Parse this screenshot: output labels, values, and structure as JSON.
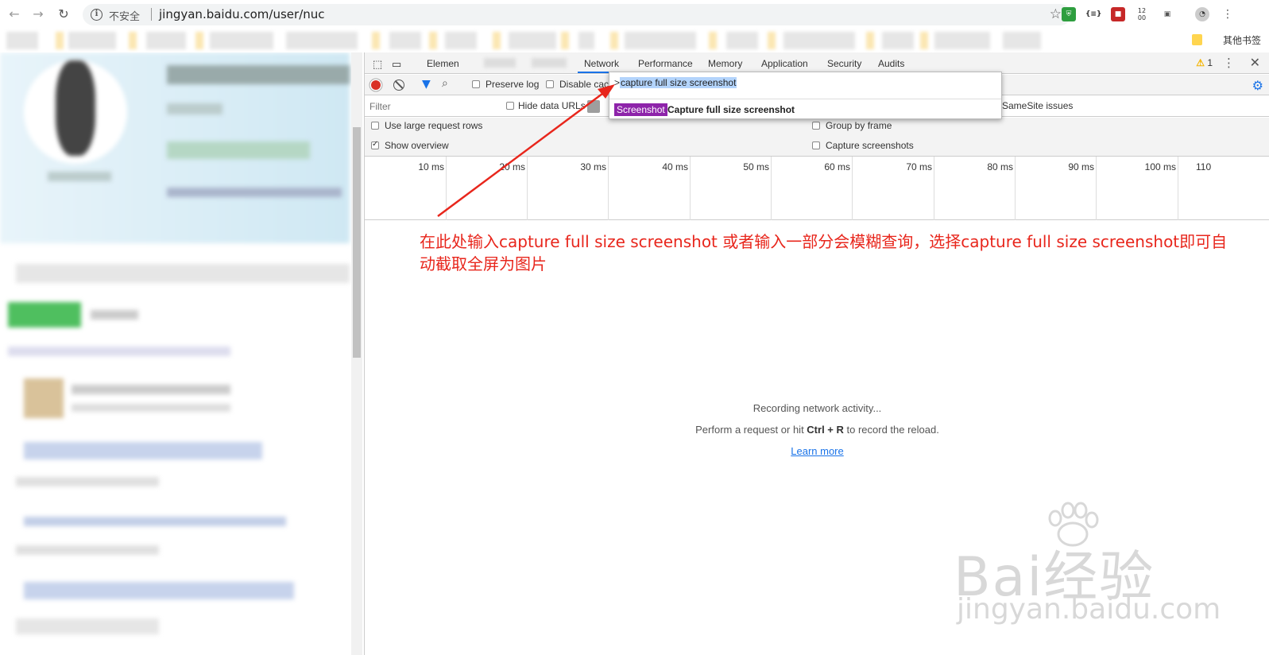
{
  "browser": {
    "url_security": "不安全",
    "url": "jingyan.baidu.com/user/nuc",
    "bookmark_other": "其他书签",
    "ext_clock": "12\n00"
  },
  "devtools": {
    "tabs": [
      "Elemen",
      "Network",
      "Performance",
      "Memory",
      "Application",
      "Security",
      "Audits"
    ],
    "active_tab": "Network",
    "warnings_count": "1",
    "toolbar": {
      "preserve_log": "Preserve log",
      "disable_cache": "Disable cach"
    },
    "filter_placeholder": "Filter",
    "hide_data_urls": "Hide data URLs",
    "samesite": "SameSite issues",
    "settings": {
      "large_rows": "Use large request rows",
      "show_overview": "Show overview",
      "group_by_frame": "Group by frame",
      "capture_screenshots": "Capture screenshots"
    },
    "overview_ticks": [
      "10 ms",
      "20 ms",
      "30 ms",
      "40 ms",
      "50 ms",
      "60 ms",
      "70 ms",
      "80 ms",
      "90 ms",
      "100 ms",
      "110"
    ],
    "empty": {
      "line1": "Recording network activity...",
      "line2_pre": "Perform a request or hit ",
      "line2_key": "Ctrl + R",
      "line2_post": " to record the reload.",
      "learn_more": "Learn more"
    }
  },
  "command_menu": {
    "prompt": ">",
    "query": "capture full size screenshot",
    "result_category": "Screenshot",
    "result_label": "Capture full size screenshot"
  },
  "annotation": {
    "text": "在此处输入capture full size screenshot 或者输入一部分会模糊查询，选择capture full size screenshot即可自动截取全屏为图片",
    "color": "#e8261c"
  },
  "watermark": {
    "main": "Bai经验",
    "sub": "jingyan.baidu.com"
  }
}
